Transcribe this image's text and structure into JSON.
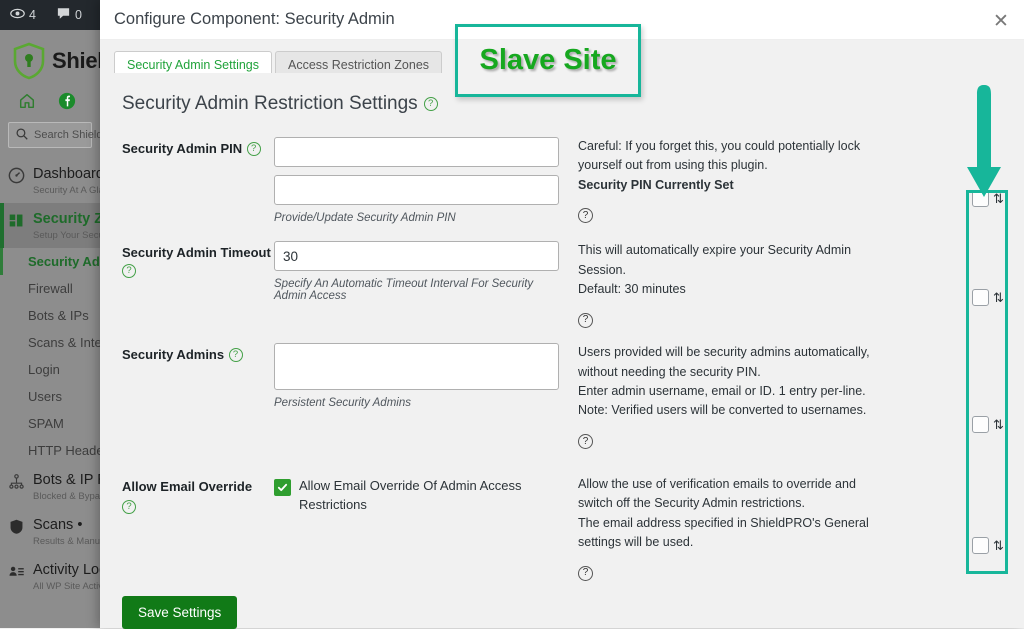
{
  "adminbar": {
    "items": [
      {
        "icon": "eye-icon",
        "count": "4"
      },
      {
        "icon": "comment-icon",
        "count": "0"
      },
      {
        "icon": "plus-icon",
        "count": ""
      }
    ]
  },
  "sidebar": {
    "logo_text": "Shield",
    "logo_icon": "shield-lock-icon",
    "quick_icons": [
      "home-icon",
      "facebook-icon",
      "share-icon"
    ],
    "search": {
      "placeholder": "Search ShieldPRO",
      "icon": "search-icon"
    },
    "items": [
      {
        "title": "Dashboard",
        "sub": "Security At A Glance",
        "icon": "gauge-icon",
        "active": false
      },
      {
        "title": "Security Zones",
        "sub": "Setup Your Security",
        "icon": "zones-icon",
        "active": true
      }
    ],
    "submenu": [
      {
        "label": "Security Admin",
        "active": true
      },
      {
        "label": "Firewall",
        "active": false
      },
      {
        "label": "Bots & IPs",
        "active": false
      },
      {
        "label": "Scans & Integrity",
        "active": false
      },
      {
        "label": "Login",
        "active": false
      },
      {
        "label": "Users",
        "active": false
      },
      {
        "label": "SPAM",
        "active": false
      },
      {
        "label": "HTTP Headers",
        "active": false
      }
    ],
    "items_bottom": [
      {
        "title": "Bots & IP Rules",
        "sub": "Blocked & Bypass",
        "icon": "network-icon"
      },
      {
        "title": "Scans •",
        "sub": "Results & Manual",
        "icon": "shield-icon"
      },
      {
        "title": "Activity Logs",
        "sub": "All WP Site Activity",
        "icon": "user-list-icon"
      }
    ]
  },
  "modal": {
    "title": "Configure Component: Security Admin",
    "close_icon": "close-icon",
    "tabs": [
      {
        "label": "Security Admin Settings",
        "active": true
      },
      {
        "label": "Access Restriction Zones",
        "active": false
      }
    ],
    "section_heading": "Security Admin Restriction Settings",
    "help_icon": "question-icon",
    "save_label": "Save Settings"
  },
  "rows": [
    {
      "label": "Security Admin PIN",
      "field_type": "two-text",
      "value1": "",
      "value2": "",
      "hint": "Provide/Update Security Admin PIN",
      "desc": [
        {
          "text": "Careful: If you forget this, you could potentially lock yourself out from using this plugin.",
          "bold": false
        },
        {
          "text": "Security PIN Currently Set",
          "bold": true
        }
      ],
      "checkbox_checked": false
    },
    {
      "label": "Security Admin Timeout",
      "field_type": "text",
      "value1": "30",
      "hint": "Specify An Automatic Timeout Interval For Security Admin Access",
      "desc": [
        {
          "text": "This will automatically expire your Security Admin Session.",
          "bold": false
        },
        {
          "text": "Default: 30 minutes",
          "bold": false
        }
      ],
      "checkbox_checked": false
    },
    {
      "label": "Security Admins",
      "field_type": "textarea",
      "value1": "",
      "hint": "Persistent Security Admins",
      "desc": [
        {
          "text": "Users provided will be security admins automatically, without needing the security PIN.",
          "bold": false
        },
        {
          "text": "Enter admin username, email or ID. 1 entry per-line.",
          "bold": false
        },
        {
          "text": "Note: Verified users will be converted to usernames.",
          "bold": false
        }
      ],
      "checkbox_checked": false
    },
    {
      "label": "Allow Email Override",
      "field_type": "checkbox",
      "checkbox_label": "Allow Email Override Of Admin Access Restrictions",
      "checkbox_value": true,
      "desc": [
        {
          "text": "Allow the use of verification emails to override and switch off the Security Admin restrictions.",
          "bold": false
        },
        {
          "text": "The email address specified in ShieldPRO's General settings will be used.",
          "bold": false
        }
      ],
      "checkbox_checked": false
    }
  ],
  "annotations": {
    "slave_site_label": "Slave Site",
    "slave_box_color": "#17b69a",
    "slave_text_color": "#16a81f",
    "arrow_color": "#17b69a",
    "highlight_box_color": "#17b69a",
    "arrow_icon": "down-arrow-icon"
  },
  "right_column": {
    "sort_icon": "sort-transfer-icon",
    "checkbox_icon": "checkbox-unchecked-icon"
  }
}
